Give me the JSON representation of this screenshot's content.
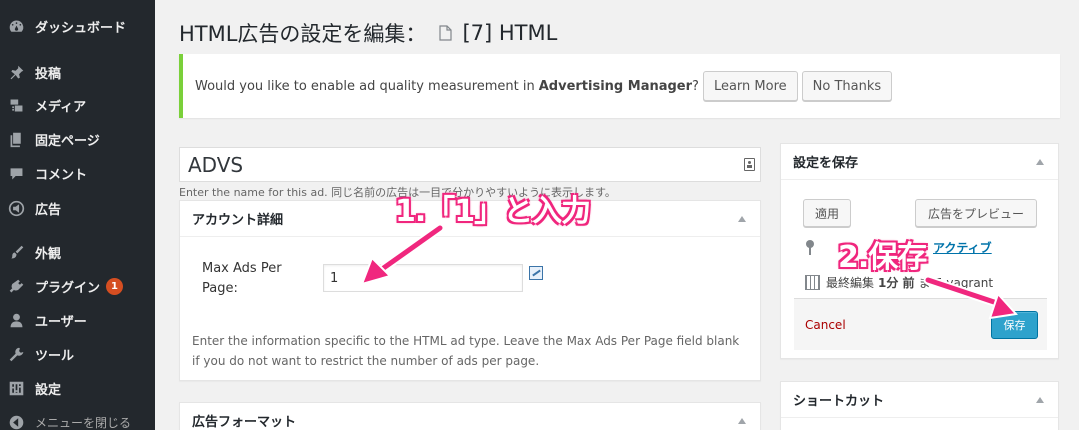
{
  "sidebar": {
    "items": [
      {
        "label": "ダッシュボード",
        "icon": "dashboard-icon"
      },
      {
        "label": "投稿",
        "icon": "pin-icon"
      },
      {
        "label": "メディア",
        "icon": "media-icon"
      },
      {
        "label": "固定ページ",
        "icon": "page-icon"
      },
      {
        "label": "コメント",
        "icon": "comment-icon"
      },
      {
        "label": "広告",
        "icon": "megaphone-icon"
      },
      {
        "label": "外観",
        "icon": "brush-icon"
      },
      {
        "label": "プラグイン",
        "icon": "plugin-icon",
        "badge": "1"
      },
      {
        "label": "ユーザー",
        "icon": "user-icon"
      },
      {
        "label": "ツール",
        "icon": "wrench-icon"
      },
      {
        "label": "設定",
        "icon": "settings-icon"
      },
      {
        "label": "メニューを閉じる",
        "icon": "collapse-icon"
      }
    ]
  },
  "page": {
    "title": "HTML広告の設定を編集：",
    "subtitle": "[7] HTML"
  },
  "notice": {
    "text": "Would you like to enable ad quality measurement in",
    "brand": "Advertising Manager",
    "suffix": "?",
    "learn_more": "Learn More",
    "no_thanks": "No Thanks"
  },
  "ad": {
    "name": "ADVS",
    "name_help": "Enter the name for this ad. 同じ名前の広告は一目で分かりやすいように表示します。"
  },
  "account": {
    "header": "アカウント詳細",
    "field_label": "Max Ads Per Page:",
    "field_value": "1",
    "help": "Enter the information specific to the HTML ad type. Leave the Max Ads Per Page field blank if you do not want to restrict the number of ads per page."
  },
  "format": {
    "header": "広告フォーマット"
  },
  "save": {
    "header": "設定を保存",
    "apply": "適用",
    "preview": "広告をプレビュー",
    "status": "アクティブ",
    "edit_prefix": "最終編集",
    "edit_time": "1分 前",
    "edit_by": "まで vagrant",
    "cancel": "Cancel",
    "save_button": "保存"
  },
  "shortcut": {
    "header": "ショートカット"
  },
  "annotations": {
    "step1": "1.「1」と入力",
    "step2": "2.保存"
  },
  "colors": {
    "sidebar_bg": "#23282d",
    "notice_border": "#7ad03a",
    "primary": "#2ea2cc",
    "annotation": "#f0277e"
  }
}
